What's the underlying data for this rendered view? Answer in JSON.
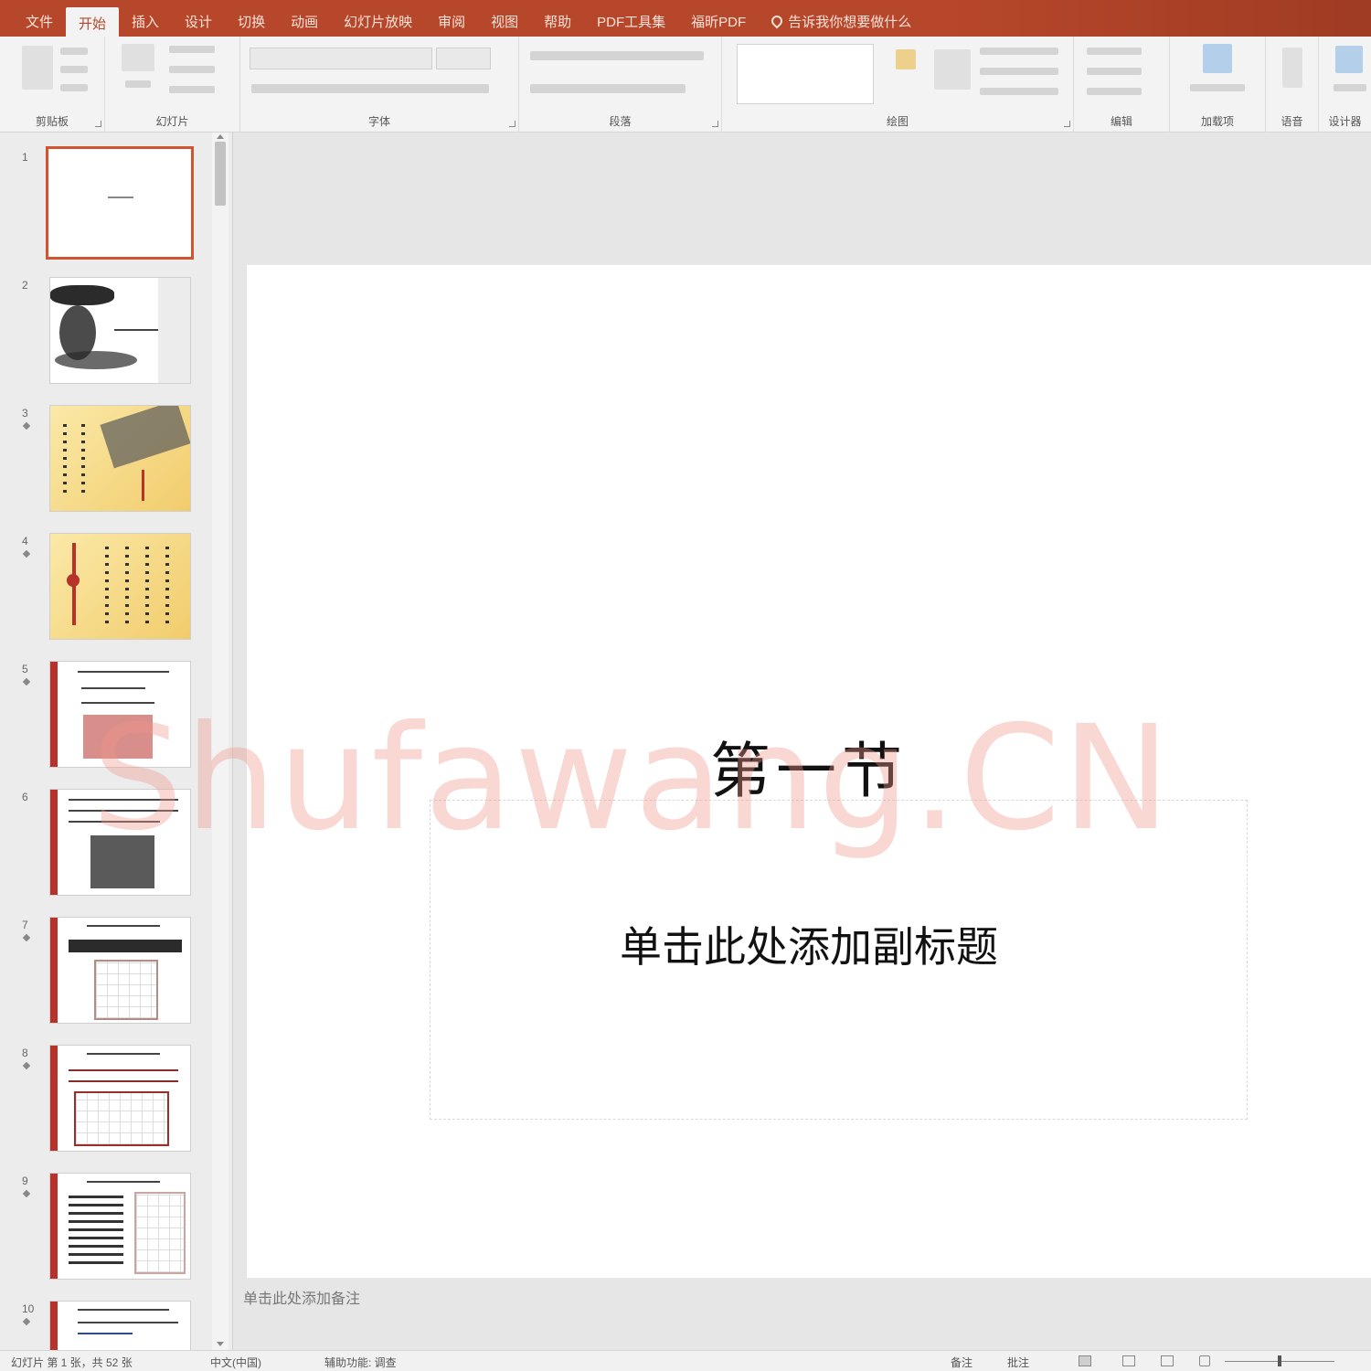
{
  "ribbon_tabs": [
    {
      "label": "文件",
      "active": false
    },
    {
      "label": "开始",
      "active": true
    },
    {
      "label": "插入",
      "active": false
    },
    {
      "label": "设计",
      "active": false
    },
    {
      "label": "切换",
      "active": false
    },
    {
      "label": "动画",
      "active": false
    },
    {
      "label": "幻灯片放映",
      "active": false
    },
    {
      "label": "审阅",
      "active": false
    },
    {
      "label": "视图",
      "active": false
    },
    {
      "label": "帮助",
      "active": false
    },
    {
      "label": "PDF工具集",
      "active": false
    },
    {
      "label": "福昕PDF",
      "active": false
    },
    {
      "label": "告诉我你想要做什么",
      "active": false
    }
  ],
  "ribbon_groups": [
    {
      "label": "剪贴板"
    },
    {
      "label": "幻灯片"
    },
    {
      "label": "字体"
    },
    {
      "label": "段落"
    },
    {
      "label": "绘图"
    },
    {
      "label": "编辑"
    },
    {
      "label": "加载项"
    },
    {
      "label": "语音"
    },
    {
      "label": "设计器"
    }
  ],
  "thumbnails": [
    {
      "number": "1",
      "selected": true
    },
    {
      "number": "2",
      "selected": false
    },
    {
      "number": "3",
      "selected": false
    },
    {
      "number": "4",
      "selected": false
    },
    {
      "number": "5",
      "selected": false
    },
    {
      "number": "6",
      "selected": false
    },
    {
      "number": "7",
      "selected": false
    },
    {
      "number": "8",
      "selected": false
    },
    {
      "number": "9",
      "selected": false
    },
    {
      "number": "10",
      "selected": false
    }
  ],
  "slide": {
    "title": "第一节",
    "subtitle": "单击此处添加副标题"
  },
  "notes_placeholder": "单击此处添加备注",
  "watermark": "Shufawang.CN",
  "statusbar": {
    "slide_counter": "幻灯片 第 1 张，共 52 张",
    "language": "中文(中国)",
    "accessibility": "辅助功能: 调查",
    "notes_label": "备注",
    "comments_label": "批注"
  },
  "colors": {
    "accent": "#b7472a",
    "selection": "#d35230",
    "watermark": "#f0968c"
  },
  "icons": [
    "paste-icon",
    "new-slide-icon",
    "find-icon",
    "replace-icon",
    "select-icon",
    "dictate-icon",
    "designer-icon",
    "normal-view-icon",
    "slide-sorter-icon",
    "reading-view-icon",
    "slideshow-icon"
  ]
}
